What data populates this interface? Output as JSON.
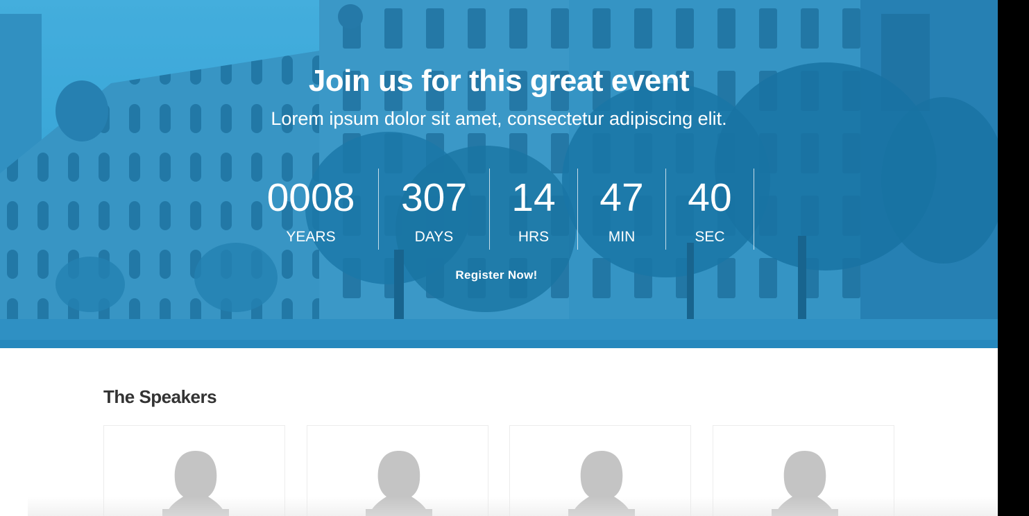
{
  "hero": {
    "title": "Join us for this great event",
    "subtitle": "Lorem ipsum dolor sit amet, consectetur adipiscing elit.",
    "countdown": [
      {
        "value": "0008",
        "label": "YEARS"
      },
      {
        "value": "307",
        "label": "DAYS"
      },
      {
        "value": "14",
        "label": "HRS"
      },
      {
        "value": "47",
        "label": "MIN"
      },
      {
        "value": "40",
        "label": "SEC"
      }
    ],
    "register_label": "Register Now!",
    "background_icon": "building-photo",
    "overlay_color": "#1b8fc7"
  },
  "speakers": {
    "title": "The Speakers",
    "cards": [
      {
        "icon": "avatar-placeholder-icon"
      },
      {
        "icon": "avatar-placeholder-icon"
      },
      {
        "icon": "avatar-placeholder-icon"
      },
      {
        "icon": "avatar-placeholder-icon"
      }
    ]
  }
}
